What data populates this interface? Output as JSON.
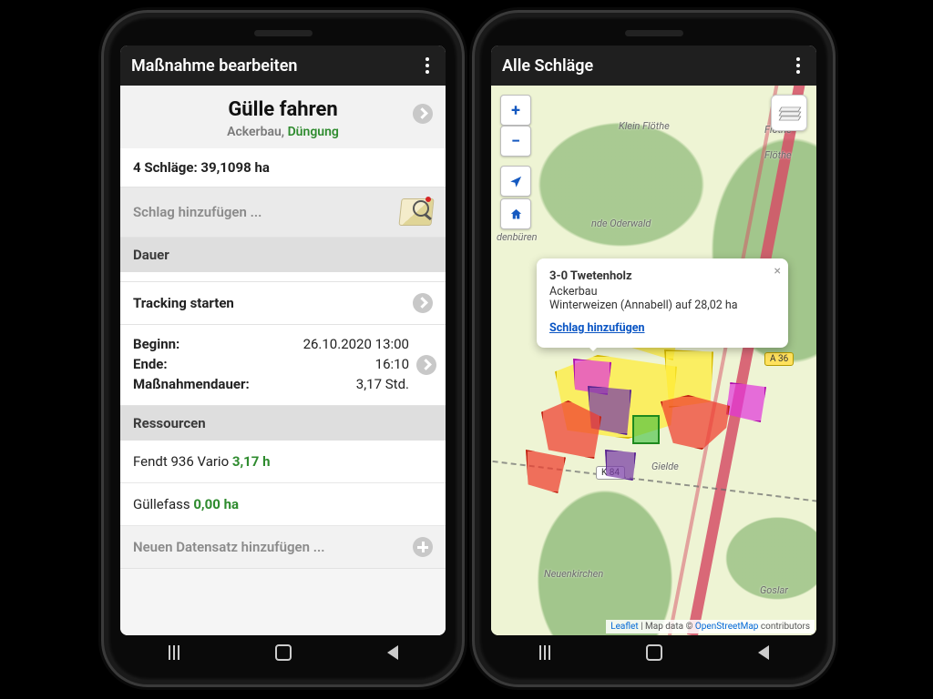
{
  "left": {
    "title_bar": "Maßnahme bearbeiten",
    "headline": "Gülle fahren",
    "category_main": "Ackerbau,",
    "category_sub": "Düngung",
    "fields_summary": "4 Schläge: 39,1098 ha",
    "add_field": "Schlag hinzufügen ...",
    "section_duration": "Dauer",
    "tracking": "Tracking starten",
    "begin_k": "Beginn:",
    "begin_v": "26.10.2020 13:00",
    "end_k": "Ende:",
    "end_v": "16:10",
    "dur_k": "Maßnahmendauer:",
    "dur_v": "3,17 Std.",
    "section_resources": "Ressourcen",
    "res1_name": "Fendt 936 Vario",
    "res1_val": "3,17 h",
    "res2_name": "Güllefass",
    "res2_val": "0,00 ha",
    "add_record": "Neuen Datensatz hinzufügen ..."
  },
  "right": {
    "title_bar": "Alle Schläge",
    "labels": {
      "klein_flothe": "Klein Flöthe",
      "flothe": "Flöthe",
      "gielde": "Gielde",
      "neuenkirchen": "Neuenkirchen",
      "goslar": "Goslar",
      "oderwald": "nde Oderwald",
      "denburen": "denbüren"
    },
    "badges": {
      "a36": "A 36",
      "k84": "K 84"
    },
    "popup": {
      "title": "3-0 Twetenholz",
      "line1": "Ackerbau",
      "line2": "Winterweizen (Annabell) auf 28,02 ha",
      "link": "Schlag hinzufügen"
    },
    "attribution": {
      "leaflet": "Leaflet",
      "sep": " | Map data © ",
      "osm": "OpenStreetMap",
      "tail": " contributors"
    }
  }
}
